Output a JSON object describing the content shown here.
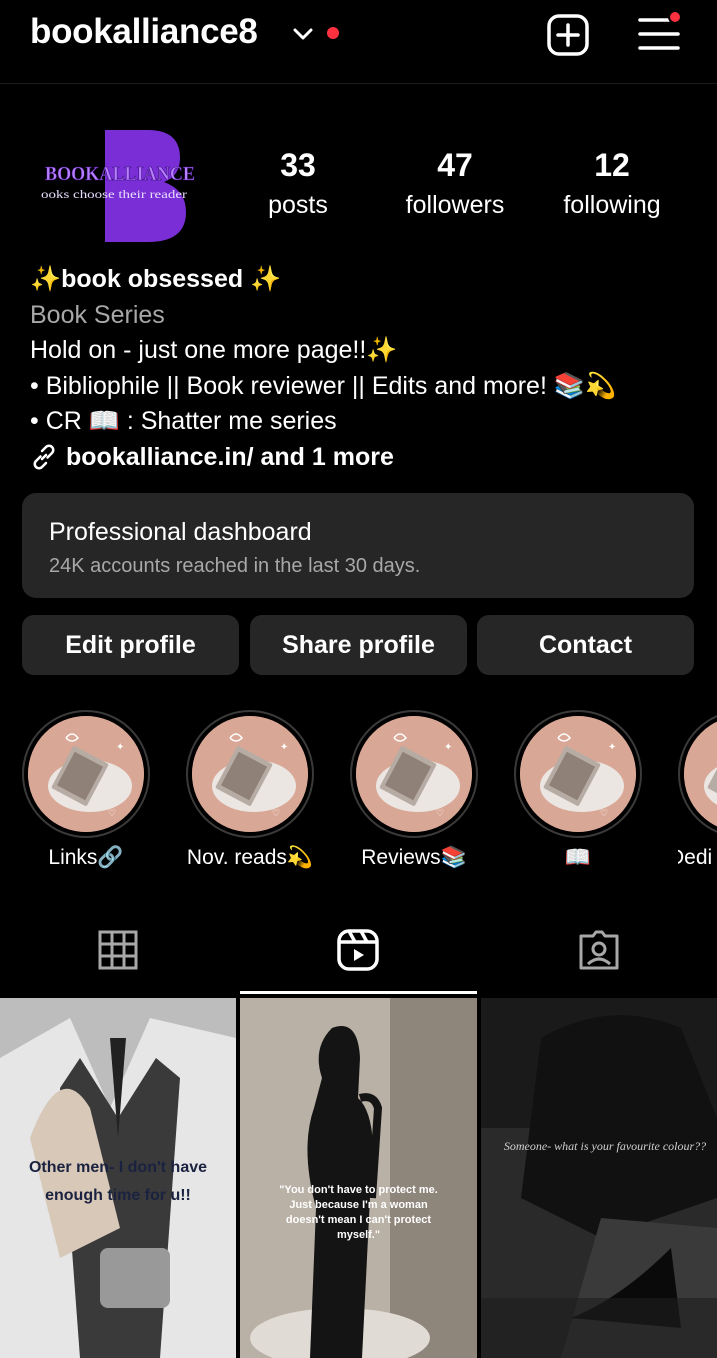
{
  "header": {
    "username": "bookalliance8"
  },
  "stats": [
    {
      "value": "33",
      "label": "posts"
    },
    {
      "value": "47",
      "label": "followers"
    },
    {
      "value": "12",
      "label": "following"
    }
  ],
  "avatar": {
    "letter": "B",
    "brand": "BOOKALLIANCE",
    "tagline": "ooks choose their reader"
  },
  "bio": {
    "name": "✨book obsessed ✨",
    "category": "Book Series",
    "lines": [
      "Hold on - just one more page!!✨",
      "• Bibliophile || Book reviewer ||  Edits and more! 📚💫",
      "• CR 📖 : Shatter me series"
    ],
    "link": "bookalliance.in/ and 1 more"
  },
  "dashboard": {
    "title": "Professional dashboard",
    "subtitle": "24K accounts reached in the last 30 days."
  },
  "buttons": {
    "edit": "Edit profile",
    "share": "Share profile",
    "contact": "Contact"
  },
  "highlights": [
    {
      "label": "Links🔗"
    },
    {
      "label": "Nov. reads💫"
    },
    {
      "label": "Reviews📚"
    },
    {
      "label": "📖"
    },
    {
      "label": "Dedi"
    }
  ],
  "posts": [
    {
      "caption": "Other men- I don't have enough time for u!!"
    },
    {
      "caption": "\"You don't have to protect me. Just because I'm a woman doesn't mean I can't protect myself.\""
    },
    {
      "caption": "Someone- what is your favourite colour??"
    }
  ],
  "colors": {
    "background": "#000000",
    "surface": "#262626",
    "secondary_text": "#a8a8a8",
    "notification": "#ff3040",
    "avatar_purple": "#7a2fd6"
  }
}
